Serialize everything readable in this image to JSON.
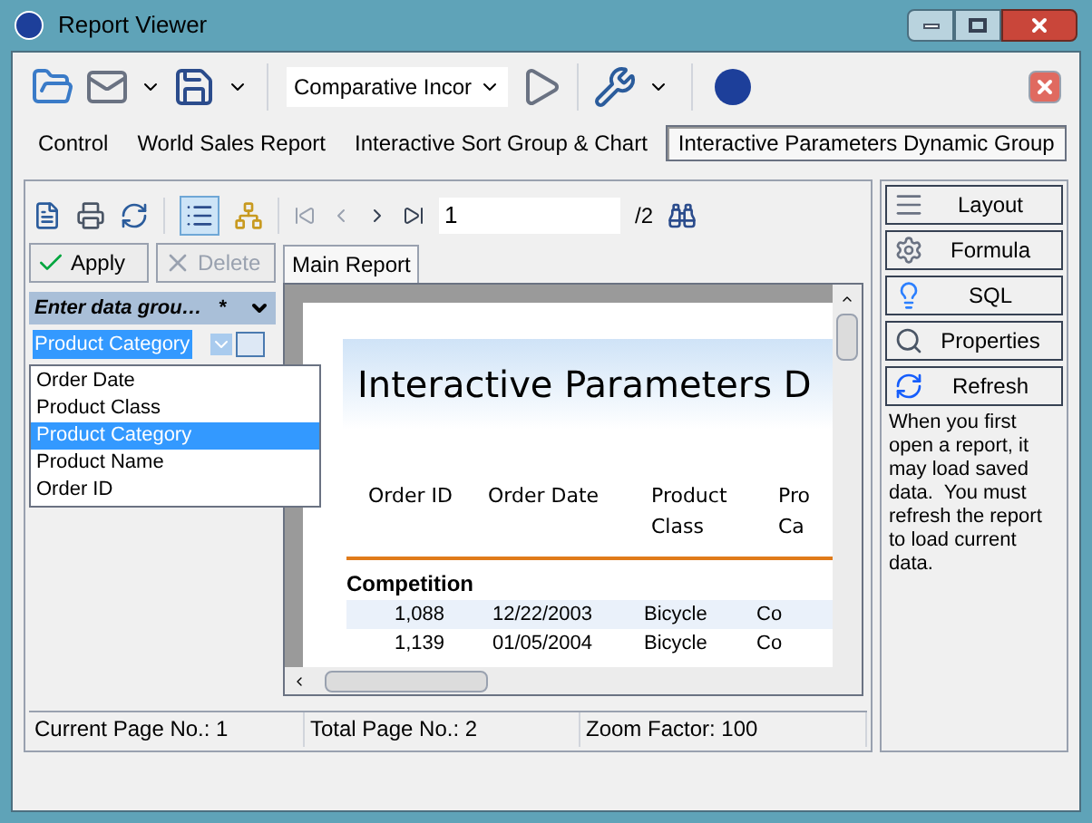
{
  "window": {
    "title": "Report Viewer"
  },
  "toolbar": {
    "report_combo": "Comparative Incor"
  },
  "tabs": [
    {
      "label": "Control",
      "selected": false
    },
    {
      "label": "World Sales Report",
      "selected": false
    },
    {
      "label": "Interactive Sort Group & Chart",
      "selected": false
    },
    {
      "label": "Interactive Parameters Dynamic Group",
      "selected": true
    }
  ],
  "viewer_toolbar": {
    "page_input": "1",
    "page_total": "/2"
  },
  "param_buttons": [
    {
      "label": "Apply",
      "disabled": false
    },
    {
      "label": "Delete",
      "disabled": true
    }
  ],
  "param_header": {
    "label": "Enter data grou…",
    "marker": "*"
  },
  "group_combo": {
    "value": "Product Category",
    "options": [
      {
        "label": "Order Date",
        "selected": false
      },
      {
        "label": "Product Class",
        "selected": false
      },
      {
        "label": "Product Category",
        "selected": true
      },
      {
        "label": "Product Name",
        "selected": false
      },
      {
        "label": "Order ID",
        "selected": false
      }
    ]
  },
  "report_tabs": [
    {
      "label": "Main Report",
      "selected": true
    }
  ],
  "report": {
    "title": "Interactive Parameters D",
    "columns": [
      "Order ID",
      "Order Date",
      "Product Class",
      "Pro Ca"
    ],
    "group": "Competition",
    "rows": [
      [
        "1,088",
        "12/22/2003",
        "Bicycle",
        "Co"
      ],
      [
        "1,139",
        "01/05/2004",
        "Bicycle",
        "Co"
      ]
    ]
  },
  "side_buttons": [
    {
      "label": "Layout",
      "kind": "layout"
    },
    {
      "label": "Formula",
      "kind": "formula"
    },
    {
      "label": "SQL",
      "kind": "sql"
    },
    {
      "label": "Properties",
      "kind": "properties"
    },
    {
      "label": "Refresh",
      "kind": "refresh"
    }
  ],
  "side_note": "When you first open a report, it may load saved data.  You must refresh the report to load current data.",
  "status_bar": [
    "Current Page No.: 1",
    "Total Page No.: 2",
    "Zoom Factor: 100"
  ]
}
